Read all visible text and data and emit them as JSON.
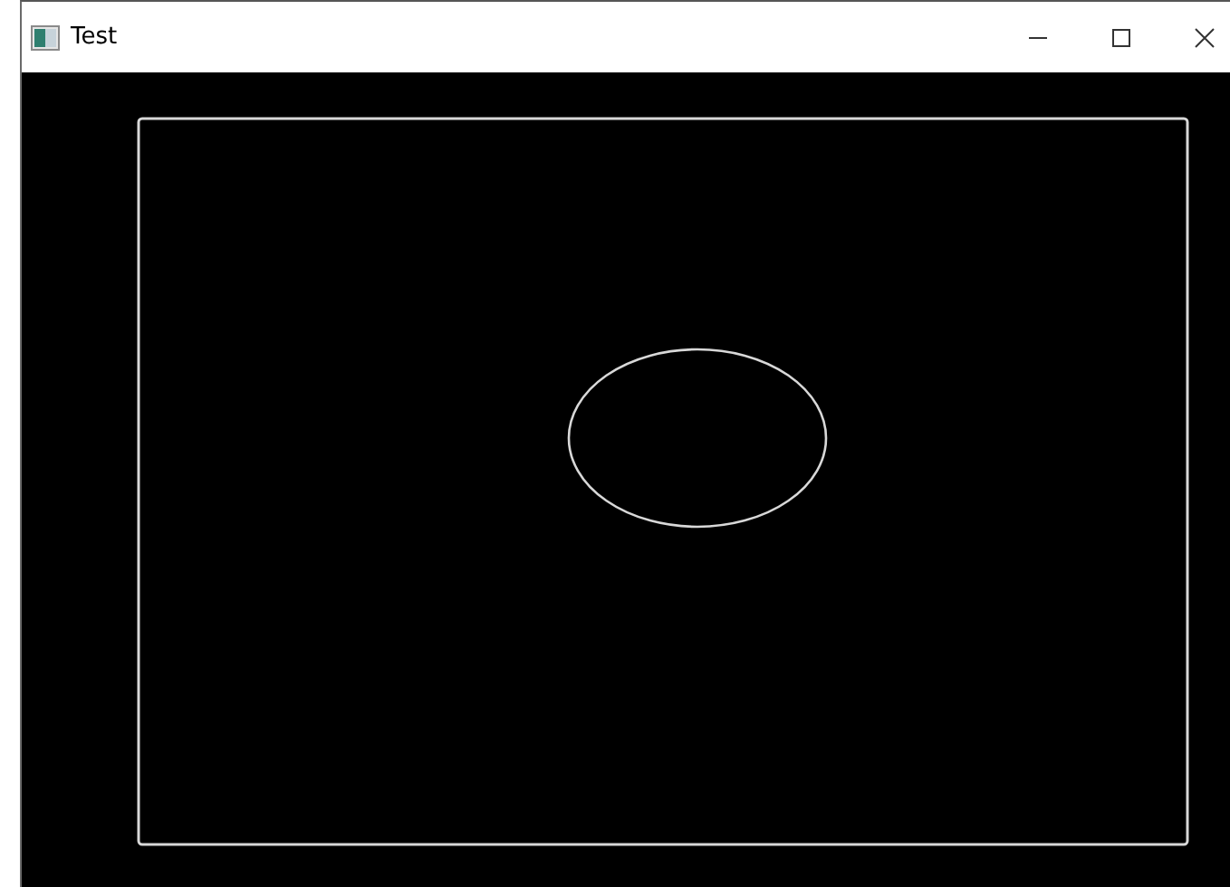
{
  "window": {
    "title": "Test"
  },
  "canvas": {
    "shapes": [
      {
        "kind": "rectangle"
      },
      {
        "kind": "ellipse"
      }
    ]
  }
}
